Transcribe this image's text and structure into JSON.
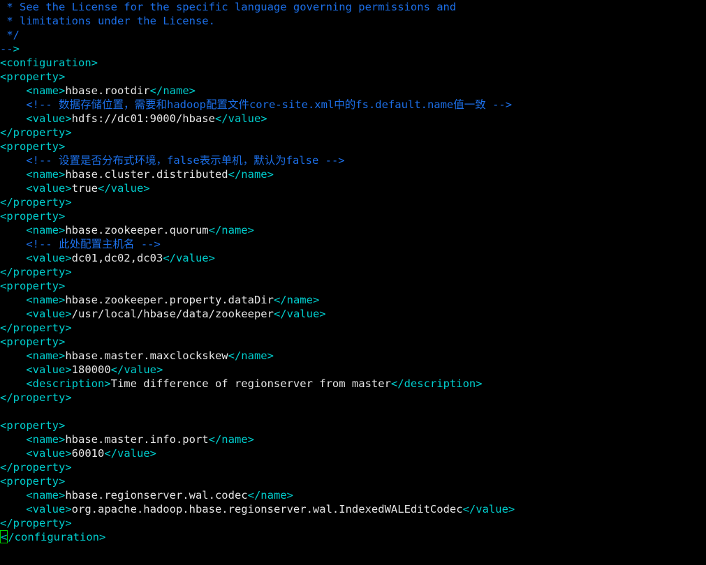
{
  "editor": {
    "title": "hbase-site.xml",
    "background_color": "#000000",
    "colors": {
      "tag": "#00cdcd",
      "text": "#e5e5e5",
      "comment": "#1c6fe8",
      "cursor_outline": "#00d700"
    },
    "cursor": {
      "char": "<",
      "line_index": 38,
      "column": 0
    },
    "lines": [
      {
        "indent": 0,
        "tokens": [
          {
            "type": "comment",
            "text": " * See the License for the specific language governing permissions and"
          }
        ]
      },
      {
        "indent": 0,
        "tokens": [
          {
            "type": "comment",
            "text": " * limitations under the License."
          }
        ]
      },
      {
        "indent": 0,
        "tokens": [
          {
            "type": "comment",
            "text": " */"
          }
        ]
      },
      {
        "indent": 0,
        "tokens": [
          {
            "type": "comment",
            "text": "--"
          },
          {
            "type": "tag",
            "text": ">"
          }
        ]
      },
      {
        "indent": 0,
        "tokens": [
          {
            "type": "tag",
            "text": "<configuration>"
          }
        ]
      },
      {
        "indent": 0,
        "tokens": [
          {
            "type": "tag",
            "text": "<property>"
          }
        ]
      },
      {
        "indent": 4,
        "tokens": [
          {
            "type": "tag",
            "text": "<name>"
          },
          {
            "type": "text",
            "text": "hbase.rootdir"
          },
          {
            "type": "tag",
            "text": "</name>"
          }
        ]
      },
      {
        "indent": 4,
        "tokens": [
          {
            "type": "comment",
            "text": "<!-- 数据存储位置，需要和hadoop配置文件core-site.xml中的fs.default.name值一致 -->"
          }
        ]
      },
      {
        "indent": 4,
        "tokens": [
          {
            "type": "tag",
            "text": "<value>"
          },
          {
            "type": "text",
            "text": "hdfs://dc01:9000/hbase"
          },
          {
            "type": "tag",
            "text": "</value>"
          }
        ]
      },
      {
        "indent": 0,
        "tokens": [
          {
            "type": "tag",
            "text": "</property>"
          }
        ]
      },
      {
        "indent": 0,
        "tokens": [
          {
            "type": "tag",
            "text": "<property>"
          }
        ]
      },
      {
        "indent": 4,
        "tokens": [
          {
            "type": "comment",
            "text": "<!-- 设置是否分布式环境，false表示单机，默认为false -->"
          }
        ]
      },
      {
        "indent": 4,
        "tokens": [
          {
            "type": "tag",
            "text": "<name>"
          },
          {
            "type": "text",
            "text": "hbase.cluster.distributed"
          },
          {
            "type": "tag",
            "text": "</name>"
          }
        ]
      },
      {
        "indent": 4,
        "tokens": [
          {
            "type": "tag",
            "text": "<value>"
          },
          {
            "type": "text",
            "text": "true"
          },
          {
            "type": "tag",
            "text": "</value>"
          }
        ]
      },
      {
        "indent": 0,
        "tokens": [
          {
            "type": "tag",
            "text": "</property>"
          }
        ]
      },
      {
        "indent": 0,
        "tokens": [
          {
            "type": "tag",
            "text": "<property>"
          }
        ]
      },
      {
        "indent": 4,
        "tokens": [
          {
            "type": "tag",
            "text": "<name>"
          },
          {
            "type": "text",
            "text": "hbase.zookeeper.quorum"
          },
          {
            "type": "tag",
            "text": "</name>"
          }
        ]
      },
      {
        "indent": 4,
        "tokens": [
          {
            "type": "comment",
            "text": "<!-- 此处配置主机名 -->"
          }
        ]
      },
      {
        "indent": 4,
        "tokens": [
          {
            "type": "tag",
            "text": "<value>"
          },
          {
            "type": "text",
            "text": "dc01,dc02,dc03"
          },
          {
            "type": "tag",
            "text": "</value>"
          }
        ]
      },
      {
        "indent": 0,
        "tokens": [
          {
            "type": "tag",
            "text": "</property>"
          }
        ]
      },
      {
        "indent": 0,
        "tokens": [
          {
            "type": "tag",
            "text": "<property>"
          }
        ]
      },
      {
        "indent": 4,
        "tokens": [
          {
            "type": "tag",
            "text": "<name>"
          },
          {
            "type": "text",
            "text": "hbase.zookeeper.property.dataDir"
          },
          {
            "type": "tag",
            "text": "</name>"
          }
        ]
      },
      {
        "indent": 4,
        "tokens": [
          {
            "type": "tag",
            "text": "<value>"
          },
          {
            "type": "text",
            "text": "/usr/local/hbase/data/zookeeper"
          },
          {
            "type": "tag",
            "text": "</value>"
          }
        ]
      },
      {
        "indent": 0,
        "tokens": [
          {
            "type": "tag",
            "text": "</property>"
          }
        ]
      },
      {
        "indent": 0,
        "tokens": [
          {
            "type": "tag",
            "text": "<property>"
          }
        ]
      },
      {
        "indent": 4,
        "tokens": [
          {
            "type": "tag",
            "text": "<name>"
          },
          {
            "type": "text",
            "text": "hbase.master.maxclockskew"
          },
          {
            "type": "tag",
            "text": "</name>"
          }
        ]
      },
      {
        "indent": 4,
        "tokens": [
          {
            "type": "tag",
            "text": "<value>"
          },
          {
            "type": "text",
            "text": "180000"
          },
          {
            "type": "tag",
            "text": "</value>"
          }
        ]
      },
      {
        "indent": 4,
        "tokens": [
          {
            "type": "tag",
            "text": "<description>"
          },
          {
            "type": "text",
            "text": "Time difference of regionserver from master"
          },
          {
            "type": "tag",
            "text": "</description>"
          }
        ]
      },
      {
        "indent": 0,
        "tokens": [
          {
            "type": "tag",
            "text": "</property>"
          }
        ]
      },
      {
        "indent": 0,
        "tokens": []
      },
      {
        "indent": 0,
        "tokens": [
          {
            "type": "tag",
            "text": "<property>"
          }
        ]
      },
      {
        "indent": 4,
        "tokens": [
          {
            "type": "tag",
            "text": "<name>"
          },
          {
            "type": "text",
            "text": "hbase.master.info.port"
          },
          {
            "type": "tag",
            "text": "</name>"
          }
        ]
      },
      {
        "indent": 4,
        "tokens": [
          {
            "type": "tag",
            "text": "<value>"
          },
          {
            "type": "text",
            "text": "60010"
          },
          {
            "type": "tag",
            "text": "</value>"
          }
        ]
      },
      {
        "indent": 0,
        "tokens": [
          {
            "type": "tag",
            "text": "</property>"
          }
        ]
      },
      {
        "indent": 0,
        "tokens": [
          {
            "type": "tag",
            "text": "<property>"
          }
        ]
      },
      {
        "indent": 4,
        "tokens": [
          {
            "type": "tag",
            "text": "<name>"
          },
          {
            "type": "text",
            "text": "hbase.regionserver.wal.codec"
          },
          {
            "type": "tag",
            "text": "</name>"
          }
        ]
      },
      {
        "indent": 4,
        "tokens": [
          {
            "type": "tag",
            "text": "<value>"
          },
          {
            "type": "text",
            "text": "org.apache.hadoop.hbase.regionserver.wal.IndexedWALEditCodec"
          },
          {
            "type": "tag",
            "text": "</value>"
          }
        ]
      },
      {
        "indent": 0,
        "tokens": [
          {
            "type": "tag",
            "text": "</property>"
          }
        ]
      },
      {
        "indent": 0,
        "cursor_at": 0,
        "tokens": [
          {
            "type": "tag",
            "text": "</configuration>"
          }
        ]
      }
    ]
  }
}
